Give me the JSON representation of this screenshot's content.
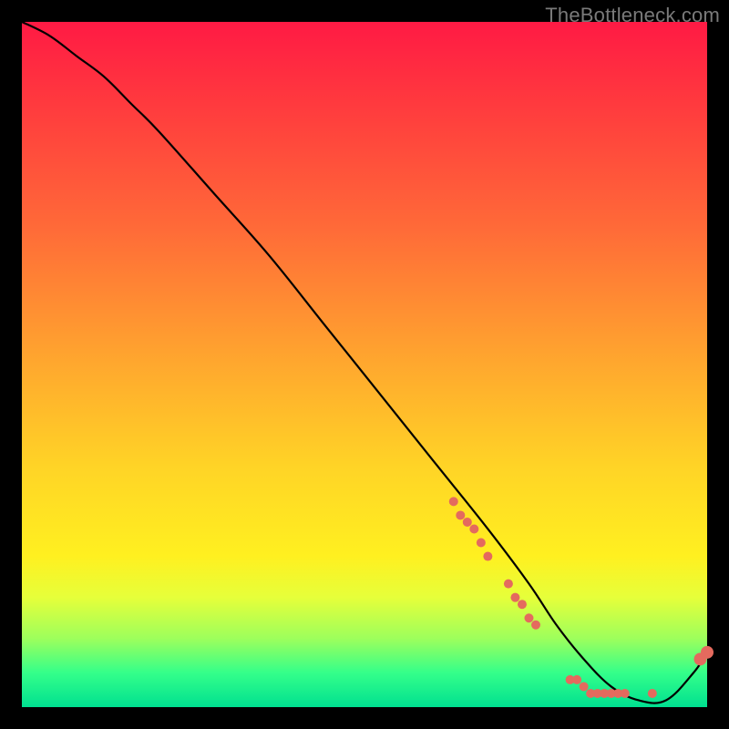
{
  "watermark": "TheBottleneck.com",
  "chart_data": {
    "type": "line",
    "title": "",
    "xlabel": "",
    "ylabel": "",
    "xlim": [
      0,
      100
    ],
    "ylim": [
      0,
      100
    ],
    "grid": false,
    "legend": false,
    "series": [
      {
        "name": "bottleneck-curve",
        "color": "#000000",
        "x": [
          0,
          4,
          8,
          12,
          16,
          20,
          28,
          36,
          44,
          52,
          60,
          68,
          74,
          78,
          82,
          86,
          90,
          94,
          98,
          100
        ],
        "y": [
          100,
          98,
          95,
          92,
          88,
          84,
          75,
          66,
          56,
          46,
          36,
          26,
          18,
          12,
          7,
          3,
          1,
          1,
          5,
          8
        ]
      }
    ],
    "markers": {
      "name": "highlighted-points",
      "color": "#e46a5e",
      "radius_small": 5,
      "radius_large": 7,
      "points": [
        {
          "x": 63,
          "y": 30,
          "r": "small"
        },
        {
          "x": 64,
          "y": 28,
          "r": "small"
        },
        {
          "x": 65,
          "y": 27,
          "r": "small"
        },
        {
          "x": 66,
          "y": 26,
          "r": "small"
        },
        {
          "x": 67,
          "y": 24,
          "r": "small"
        },
        {
          "x": 68,
          "y": 22,
          "r": "small"
        },
        {
          "x": 71,
          "y": 18,
          "r": "small"
        },
        {
          "x": 72,
          "y": 16,
          "r": "small"
        },
        {
          "x": 73,
          "y": 15,
          "r": "small"
        },
        {
          "x": 74,
          "y": 13,
          "r": "small"
        },
        {
          "x": 75,
          "y": 12,
          "r": "small"
        },
        {
          "x": 80,
          "y": 4,
          "r": "small"
        },
        {
          "x": 81,
          "y": 4,
          "r": "small"
        },
        {
          "x": 82,
          "y": 3,
          "r": "small"
        },
        {
          "x": 83,
          "y": 2,
          "r": "small"
        },
        {
          "x": 84,
          "y": 2,
          "r": "small"
        },
        {
          "x": 85,
          "y": 2,
          "r": "small"
        },
        {
          "x": 86,
          "y": 2,
          "r": "small"
        },
        {
          "x": 87,
          "y": 2,
          "r": "small"
        },
        {
          "x": 88,
          "y": 2,
          "r": "small"
        },
        {
          "x": 92,
          "y": 2,
          "r": "small"
        },
        {
          "x": 99,
          "y": 7,
          "r": "large"
        },
        {
          "x": 100,
          "y": 8,
          "r": "large"
        }
      ]
    }
  }
}
